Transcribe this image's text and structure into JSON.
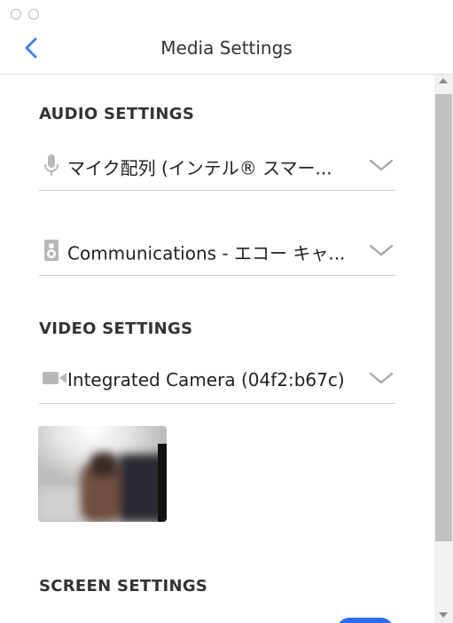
{
  "header": {
    "title": "Media Settings"
  },
  "audio": {
    "section_title": "AUDIO SETTINGS",
    "microphone": {
      "value": "マイク配列 (インテル® スマー...",
      "icon": "microphone-icon"
    },
    "speaker": {
      "value": "Communications - エコー キャ...",
      "icon": "speaker-icon"
    }
  },
  "video": {
    "section_title": "VIDEO SETTINGS",
    "camera": {
      "value": "Integrated Camera (04f2:b67c)",
      "icon": "video-camera-icon"
    }
  },
  "screen": {
    "section_title": "SCREEN SETTINGS"
  },
  "colors": {
    "accent": "#3b82f6",
    "toggle_on": "#2d6cf0"
  }
}
